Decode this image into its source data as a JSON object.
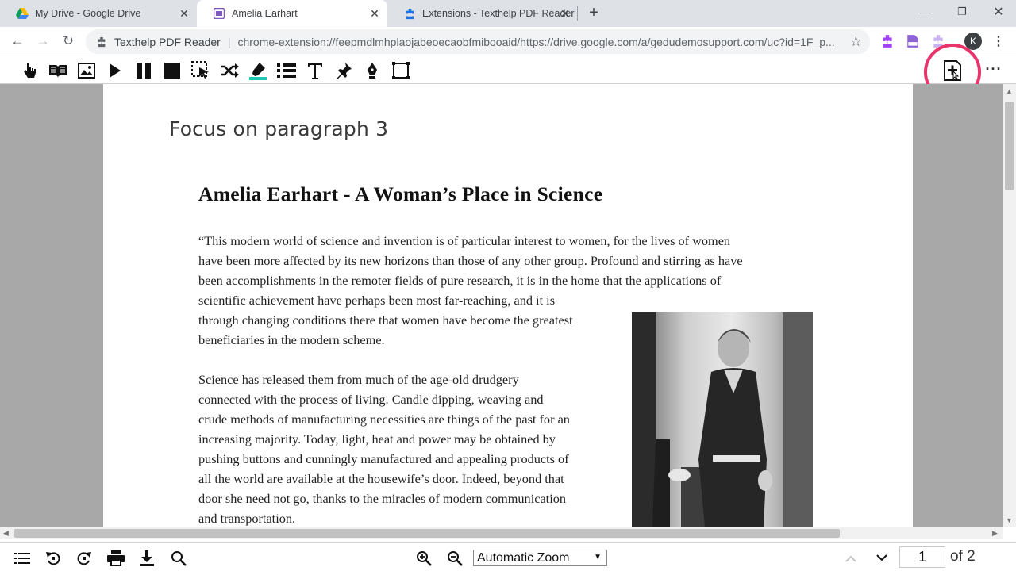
{
  "tabs": [
    {
      "title": "My Drive - Google Drive",
      "active": false
    },
    {
      "title": "Amelia Earhart",
      "active": true
    },
    {
      "title": "Extensions - Texthelp PDF Reader",
      "active": false
    }
  ],
  "omnibox": {
    "origin": "Texthelp PDF Reader",
    "separator": "|",
    "url": "chrome-extension://feepmdlmhplaojabeoecaobfmibooaid/https://drive.google.com/a/gedudemosupport.com/uc?id=1F_p..."
  },
  "profile_initial": "K",
  "pdf_toolbar": {
    "tools": [
      "hover-speech",
      "reader",
      "image",
      "play",
      "pause",
      "stop",
      "selection-reader",
      "shuffle",
      "highlighter",
      "list",
      "text",
      "pin",
      "pen",
      "frame"
    ]
  },
  "page": {
    "focus_heading": "Focus on paragraph 3",
    "doc_title": "Amelia Earhart - A Woman’s Place in Science",
    "paragraph1": [
      "“This modern world of science and invention is of particular interest to women, for the lives of women",
      "have been more affected by its new horizons than those of any other group. Profound and stirring as have",
      "been accomplishments in the remoter fields of pure research, it is in the home that the applications of",
      "scientific achievement have perhaps been most far-reaching, and it is",
      "through changing conditions there that women have become the greatest",
      "beneficiaries in the modern scheme."
    ],
    "paragraph2": [
      "Science has released them from much of the age-old drudgery",
      "connected with the process of living. Candle dipping, weaving and",
      "crude methods of manufacturing necessities are things of the past for an",
      "increasing majority. Today, light, heat and power may be obtained by",
      "pushing buttons and cunningly manufactured and appealing products of",
      "all the world are available at the housewife’s door. Indeed, beyond that",
      "door she need not go, thanks to the miracles of modern communication",
      "and transportation."
    ]
  },
  "bottom_toolbar": {
    "zoom": "Automatic Zoom",
    "page_number": "1",
    "page_total": "of 2"
  },
  "colors": {
    "highlight_ring": "#e8336b",
    "extension_purple": "#a142f4"
  }
}
